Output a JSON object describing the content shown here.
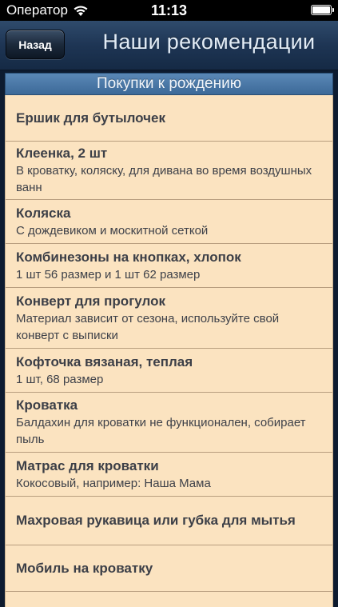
{
  "status": {
    "carrier": "Оператор",
    "time": "11:13"
  },
  "nav": {
    "back_label": "Назад",
    "title": "Наши рекомендации"
  },
  "section": {
    "header": "Покупки к рождению"
  },
  "items": [
    {
      "title": "Ершик для бутылочек",
      "subtitle": ""
    },
    {
      "title": "Клеенка, 2 шт",
      "subtitle": "В кроватку, коляску, для дивана во время воздушных ванн"
    },
    {
      "title": "Коляска",
      "subtitle": "С дождевиком и москитной сеткой"
    },
    {
      "title": "Комбинезоны на кнопках, хлопок",
      "subtitle": "1 шт 56 размер и 1 шт 62 размер"
    },
    {
      "title": "Конверт для прогулок",
      "subtitle": "Материал зависит от сезона, используйте свой конверт с выписки"
    },
    {
      "title": "Кофточка вязаная, теплая",
      "subtitle": "1 шт,  68 размер"
    },
    {
      "title": "Кроватка",
      "subtitle": "Балдахин для кроватки не функционален, собирает пыль"
    },
    {
      "title": "Матрас для кроватки",
      "subtitle": "Кокосовый, например: Наша Мама"
    },
    {
      "title": "Махровая рукавица или губка для мытья",
      "subtitle": ""
    },
    {
      "title": "Мобиль на кроватку",
      "subtitle": ""
    }
  ]
}
